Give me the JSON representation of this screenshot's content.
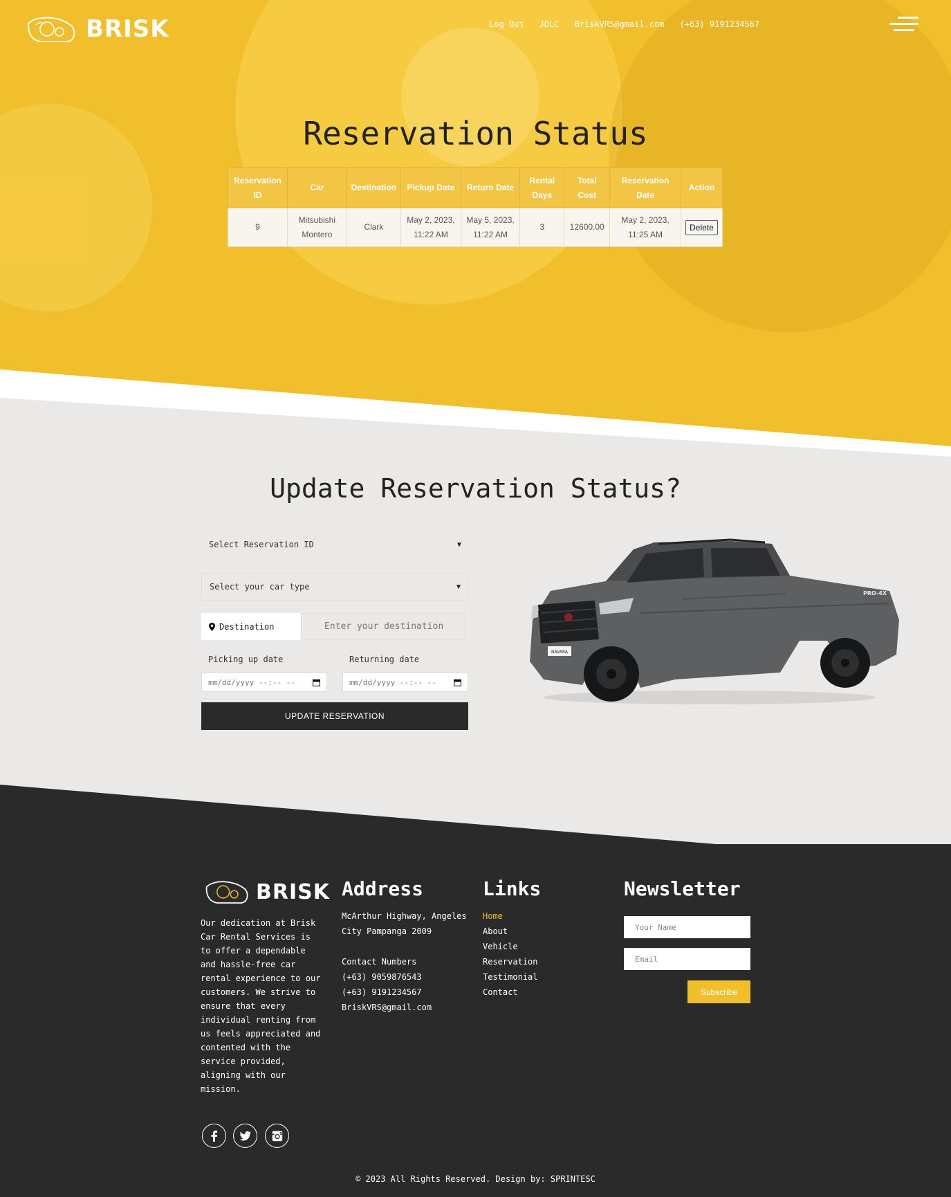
{
  "brand": {
    "name": "BRISK"
  },
  "nav": {
    "logout": "Log Out",
    "user": "JDLC",
    "email": "BriskVRS@gmail.com",
    "phone": "(+63) 9191234567"
  },
  "status": {
    "title": "Reservation Status",
    "headers": [
      "Reservation ID",
      "Car",
      "Destination",
      "Pickup Date",
      "Return Date",
      "Rental Days",
      "Total Cost",
      "Reservation Date",
      "Action"
    ],
    "row": {
      "id": "9",
      "car": "Mitsubishi Montero",
      "destination": "Clark",
      "pickup": "May 2, 2023, 11:22 AM",
      "return": "May 5, 2023, 11:22 AM",
      "days": "3",
      "cost": "12600.00",
      "reserved": "May 2, 2023, 11:25 AM",
      "action": "Delete"
    }
  },
  "update": {
    "title": "Update Reservation Status?",
    "select_id": "Select Reservation ID",
    "select_car": "Select your car type",
    "destination_label": "Destination",
    "destination_placeholder": "Enter your destination",
    "pickup_label": "Picking up date",
    "return_label": "Returning date",
    "date_placeholder": "mm/dd/yyyy --:-- --",
    "button": "UPDATE RESERVATION",
    "truck_plate": "NAVARA",
    "truck_badge": "PRO-4X"
  },
  "footer": {
    "about": "Our dedication at Brisk Car Rental Services is to offer a dependable and hassle-free car rental experience to our customers. We strive to ensure that every individual renting from us feels appreciated and contented with the service provided, aligning with our mission.",
    "address_title": "Address",
    "address": "McArthur Highway, Angeles City Pampanga 2009",
    "contact_title": "Contact Numbers",
    "phone1": "(+63) 9059876543",
    "phone2": "(+63) 9191234567",
    "email": "BriskVRS@gmail.com",
    "links_title": "Links",
    "links": [
      "Home",
      "About",
      "Vehicle",
      "Reservation",
      "Testimonial",
      "Contact"
    ],
    "newsletter_title": "Newsletter",
    "name_placeholder": "Your Name",
    "email_placeholder": "Email",
    "subscribe": "Subscribe",
    "copyright": "© 2023 All Rights Reserved. Design by: SPRINTESC"
  },
  "colors": {
    "accent": "#f1bf2c",
    "dark": "#2a2a2a",
    "light": "#ebe9e7"
  },
  "icons": [
    "car-headlight-logo-icon",
    "menu-icon",
    "location-pin-icon",
    "calendar-icon",
    "caret-down-icon",
    "facebook-icon",
    "twitter-icon",
    "instagram-icon"
  ]
}
